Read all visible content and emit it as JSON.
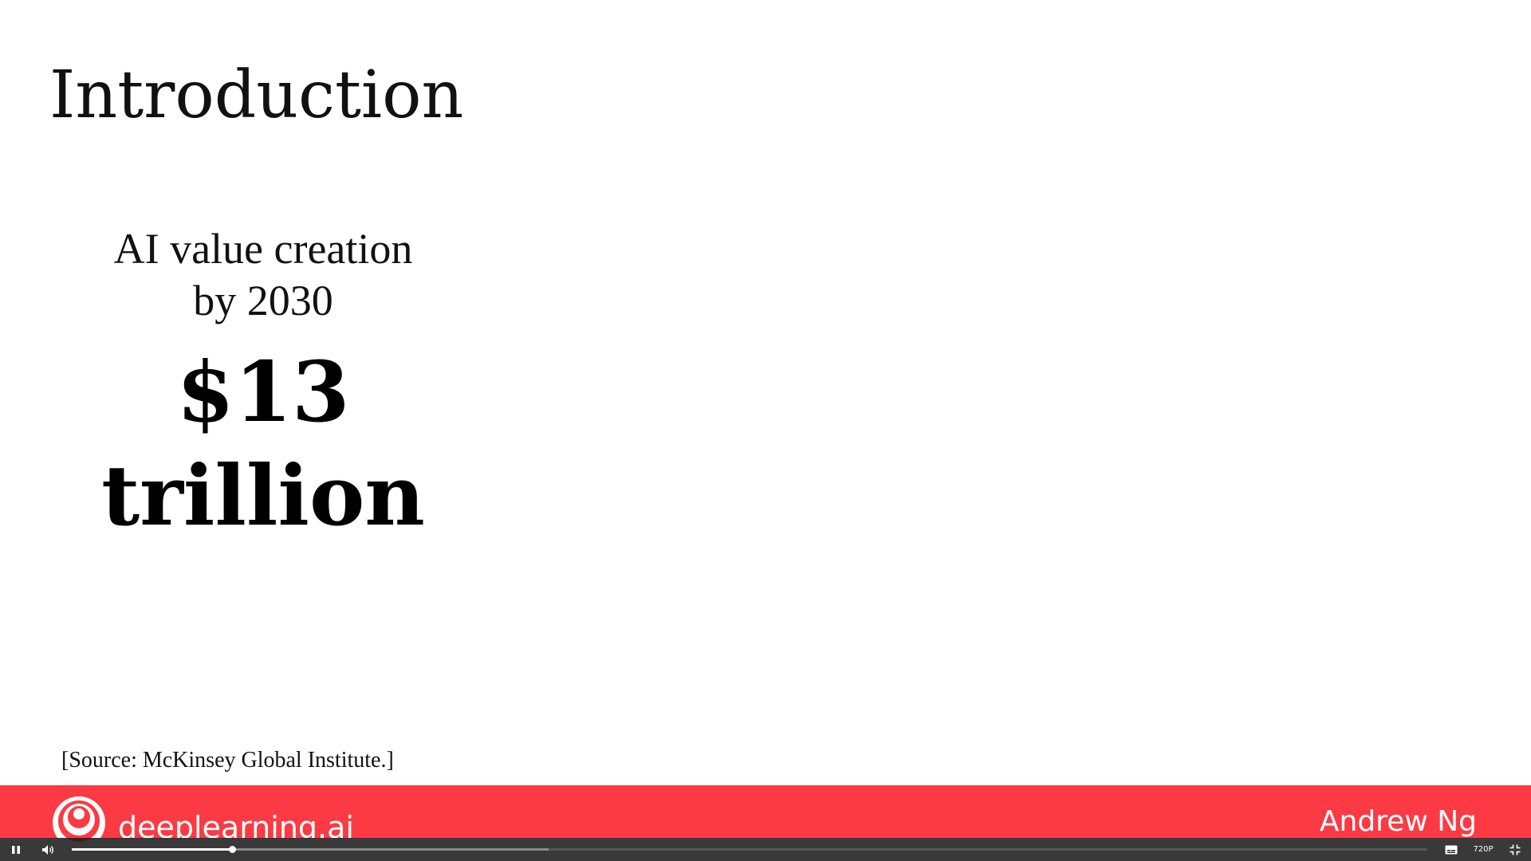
{
  "slide": {
    "title": "Introduction",
    "subtitle_line1": "AI value creation",
    "subtitle_line2": "by 2030",
    "value_line1": "$13",
    "value_line2": "trillion",
    "source": "[Source: McKinsey Global Institute.]"
  },
  "footer": {
    "brand": "deeplearning.ai",
    "author": "Andrew Ng",
    "accent_color": "#fb3a44"
  },
  "player": {
    "play_state_icon": "pause-icon",
    "volume_icon": "volume-icon",
    "played_fraction": 0.118,
    "buffered_fraction": 0.352,
    "captions_icon": "captions-icon",
    "quality": "720P",
    "fullscreen_icon": "exit-fullscreen-icon"
  }
}
